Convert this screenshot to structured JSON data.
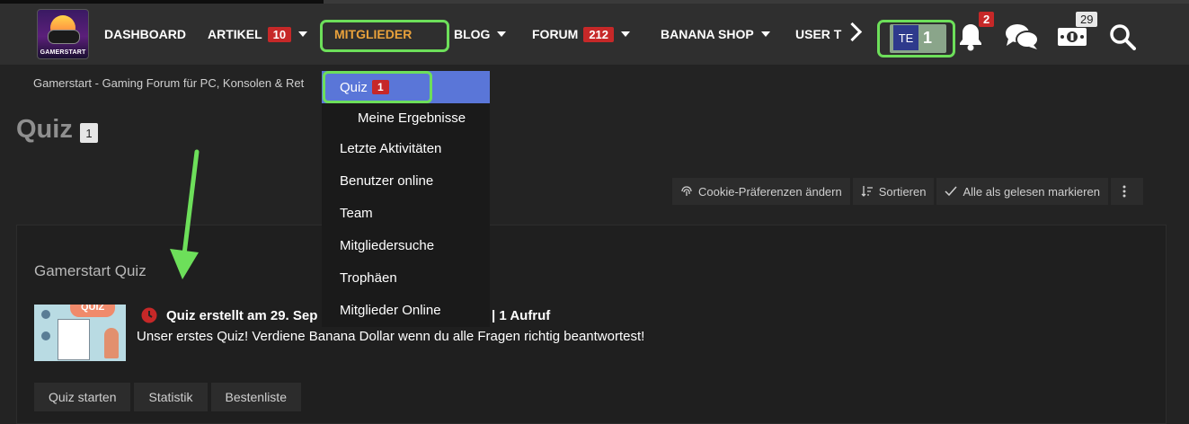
{
  "logo": {
    "text": "GAMERSTART"
  },
  "nav": {
    "items": [
      {
        "label": "DASHBOARD"
      },
      {
        "label": "ARTIKEL",
        "badge": "10"
      },
      {
        "label": "MITGLIEDER"
      },
      {
        "label": "BLOG"
      },
      {
        "label": "FORUM",
        "badge": "212"
      },
      {
        "label": "BANANA SHOP"
      },
      {
        "label": "USER TES"
      }
    ],
    "user": {
      "initials": "TE",
      "count": "1"
    },
    "notifications_badge": "2",
    "money_badge": "29"
  },
  "dropdown": {
    "items": [
      {
        "label": "Quiz",
        "badge": "1"
      },
      {
        "label": "Meine Ergebnisse"
      },
      {
        "label": "Letzte Aktivitäten"
      },
      {
        "label": "Benutzer online"
      },
      {
        "label": "Team"
      },
      {
        "label": "Mitgliedersuche"
      },
      {
        "label": "Trophäen"
      },
      {
        "label": "Mitglieder Online"
      }
    ]
  },
  "breadcrumb": "Gamerstart - Gaming Forum für PC, Konsolen & Ret",
  "page": {
    "title": "Quiz",
    "badge": "1"
  },
  "actions": [
    {
      "label": "Cookie-Präferenzen ändern"
    },
    {
      "label": "Sortieren"
    },
    {
      "label": "Alle als gelesen markieren"
    }
  ],
  "block": {
    "title": "Gamerstart Quiz",
    "quiz": {
      "thumb_text": "QUIZ",
      "title_part1": "Quiz erstellt am 29. Sep",
      "title_part2": "| 1 Aufruf",
      "description": "Unser erstes Quiz! Verdiene Banana Dollar wenn du alle Fragen richtig beantwortest!"
    },
    "buttons": [
      {
        "label": "Quiz starten"
      },
      {
        "label": "Statistik"
      },
      {
        "label": "Bestenliste"
      }
    ]
  },
  "colors": {
    "accent_green": "#6ddf5a",
    "badge_red": "#c62828",
    "active_blue": "#5a76d8",
    "nav_orange": "#e9a13b"
  }
}
